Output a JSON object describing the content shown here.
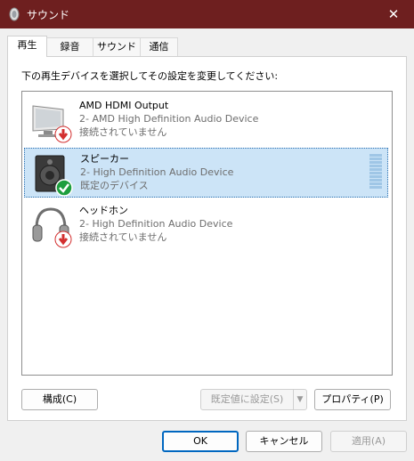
{
  "window": {
    "title": "サウンド",
    "close_glyph": "✕"
  },
  "tabs": [
    {
      "label": "再生",
      "active": true
    },
    {
      "label": "録音",
      "active": false
    },
    {
      "label": "サウンド",
      "active": false
    },
    {
      "label": "通信",
      "active": false
    }
  ],
  "instruction": "下の再生デバイスを選択してその設定を変更してください:",
  "devices": [
    {
      "name": "AMD HDMI Output",
      "description": "2- AMD High Definition Audio Device",
      "status": "接続されていません",
      "icon": "monitor-icon",
      "badge": "disconnected-badge-icon",
      "selected": false
    },
    {
      "name": "スピーカー",
      "description": "2- High Definition Audio Device",
      "status": "既定のデバイス",
      "icon": "speaker-icon",
      "badge": "default-check-icon",
      "selected": true
    },
    {
      "name": "ヘッドホン",
      "description": "2- High Definition Audio Device",
      "status": "接続されていません",
      "icon": "headphones-icon",
      "badge": "disconnected-badge-icon",
      "selected": false
    }
  ],
  "buttons": {
    "configure": "構成(C)",
    "set_default": "既定値に設定(S)",
    "properties": "プロパティ(P)",
    "ok": "OK",
    "cancel": "キャンセル",
    "apply": "適用(A)"
  },
  "colors": {
    "titlebar": "#6e1f1f",
    "selection": "#cce4f7",
    "accent": "#0067c0",
    "badge_red": "#d32f2f",
    "badge_green": "#1e9e3e"
  }
}
